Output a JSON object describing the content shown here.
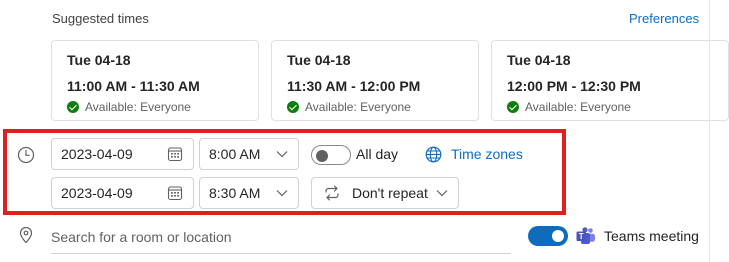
{
  "suggested": {
    "header": "Suggested times",
    "preferences_label": "Preferences",
    "cards": [
      {
        "date": "Tue 04-18",
        "time": "11:00 AM - 11:30 AM",
        "availability": "Available: Everyone"
      },
      {
        "date": "Tue 04-18",
        "time": "11:30 AM - 12:00 PM",
        "availability": "Available: Everyone"
      },
      {
        "date": "Tue 04-18",
        "time": "12:00 PM - 12:30 PM",
        "availability": "Available: Everyone"
      }
    ]
  },
  "schedule": {
    "start_date": "2023-04-09",
    "start_time": "8:00 AM",
    "end_date": "2023-04-09",
    "end_time": "8:30 AM",
    "all_day_label": "All day",
    "all_day_on": false,
    "time_zones_label": "Time zones",
    "repeat_label": "Don't repeat"
  },
  "location": {
    "placeholder": "Search for a room or location",
    "teams_label": "Teams meeting",
    "teams_on": true
  },
  "colors": {
    "accent": "#0f6cbd",
    "available": "#107c10",
    "highlight": "#e0201f"
  }
}
